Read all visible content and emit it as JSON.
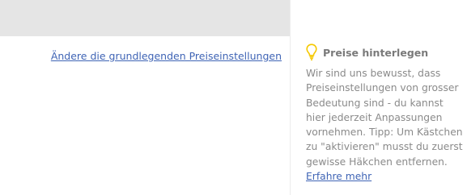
{
  "main": {
    "price_settings_link": "Ändere die grundlegenden Preiseinstellungen"
  },
  "sidebar": {
    "icon": "lightbulb-icon",
    "icon_color": "#f5c800",
    "title": "Preise hinterlegen",
    "body": "Wir sind uns bewusst, dass Preiseinstellungen von grosser Bedeutung sind - du kannst hier jederzeit Anpassungen vornehmen. Tipp: Um Kästchen zu \"aktivieren\" musst du zuerst gewisse Häkchen entfernen.",
    "learn_more": "Erfahre mehr"
  },
  "colors": {
    "link": "#3f64b5",
    "top_band": "#e5e5e5",
    "muted_text": "#8a8a8a"
  }
}
